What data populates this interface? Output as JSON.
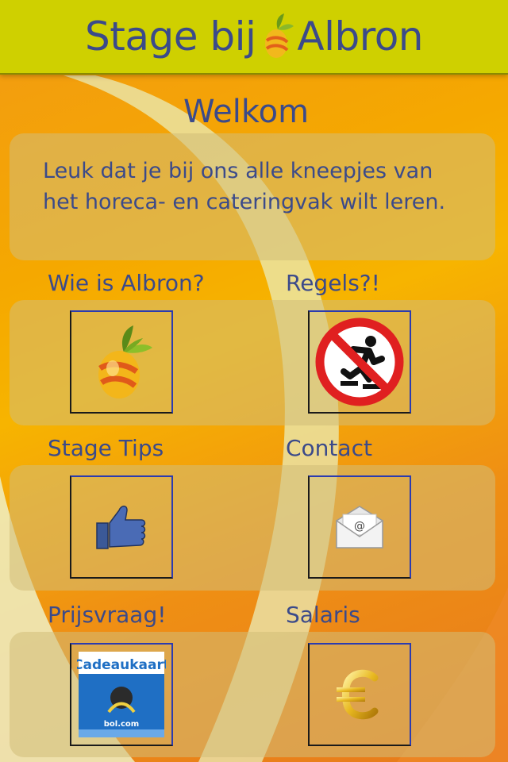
{
  "header": {
    "title_left": "Stage bij",
    "title_right": "Albron"
  },
  "welcome": {
    "title": "Welkom",
    "text": "Leuk dat je bij ons alle kneepjes van het horeca- en cateringvak wilt leren."
  },
  "menu": [
    {
      "label": "Wie is Albron?",
      "icon": "pineapple-logo-icon"
    },
    {
      "label": "Regels?!",
      "icon": "no-skating-icon"
    },
    {
      "label": "Stage Tips",
      "icon": "thumbs-up-icon"
    },
    {
      "label": "Contact",
      "icon": "email-envelope-icon"
    },
    {
      "label": "Prijsvraag!",
      "icon": "gift-card-icon"
    },
    {
      "label": "Salaris",
      "icon": "euro-icon"
    }
  ],
  "giftcard": {
    "title": "Cadeaukaart",
    "brand": "bol.com"
  },
  "colors": {
    "header_bg": "#cfd000",
    "text": "#3b4a8a",
    "background": "#f5a800",
    "panel": "#d2be78"
  }
}
